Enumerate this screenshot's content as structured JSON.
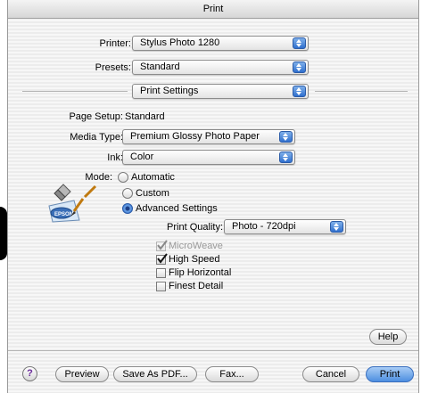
{
  "window": {
    "title": "Print"
  },
  "printer": {
    "label": "Printer:",
    "value": "Stylus Photo 1280"
  },
  "presets": {
    "label": "Presets:",
    "value": "Standard"
  },
  "panel": {
    "value": "Print Settings"
  },
  "page_setup": {
    "label": "Page Setup:",
    "value": "Standard"
  },
  "media_type": {
    "label": "Media Type:",
    "value": "Premium Glossy Photo Paper"
  },
  "ink": {
    "label": "Ink:",
    "value": "Color"
  },
  "mode": {
    "label": "Mode:",
    "options": [
      "Automatic",
      "Custom",
      "Advanced Settings"
    ],
    "selected": "Advanced Settings"
  },
  "print_quality": {
    "label": "Print Quality:",
    "value": "Photo - 720dpi"
  },
  "checkboxes": [
    {
      "label": "MicroWeave",
      "checked": true,
      "enabled": false
    },
    {
      "label": "High Speed",
      "checked": true,
      "enabled": true
    },
    {
      "label": "Flip Horizontal",
      "checked": false,
      "enabled": true
    },
    {
      "label": "Finest Detail",
      "checked": false,
      "enabled": true
    }
  ],
  "icon": {
    "name": "epson-pen-icon",
    "text": "EPSON"
  },
  "buttons": {
    "help": "Help",
    "question": "?",
    "preview": "Preview",
    "save_as_pdf": "Save As PDF...",
    "fax": "Fax...",
    "cancel": "Cancel",
    "print": "Print"
  },
  "colors": {
    "accent": "#3b76cf",
    "default_button": "#4d8ee0"
  }
}
